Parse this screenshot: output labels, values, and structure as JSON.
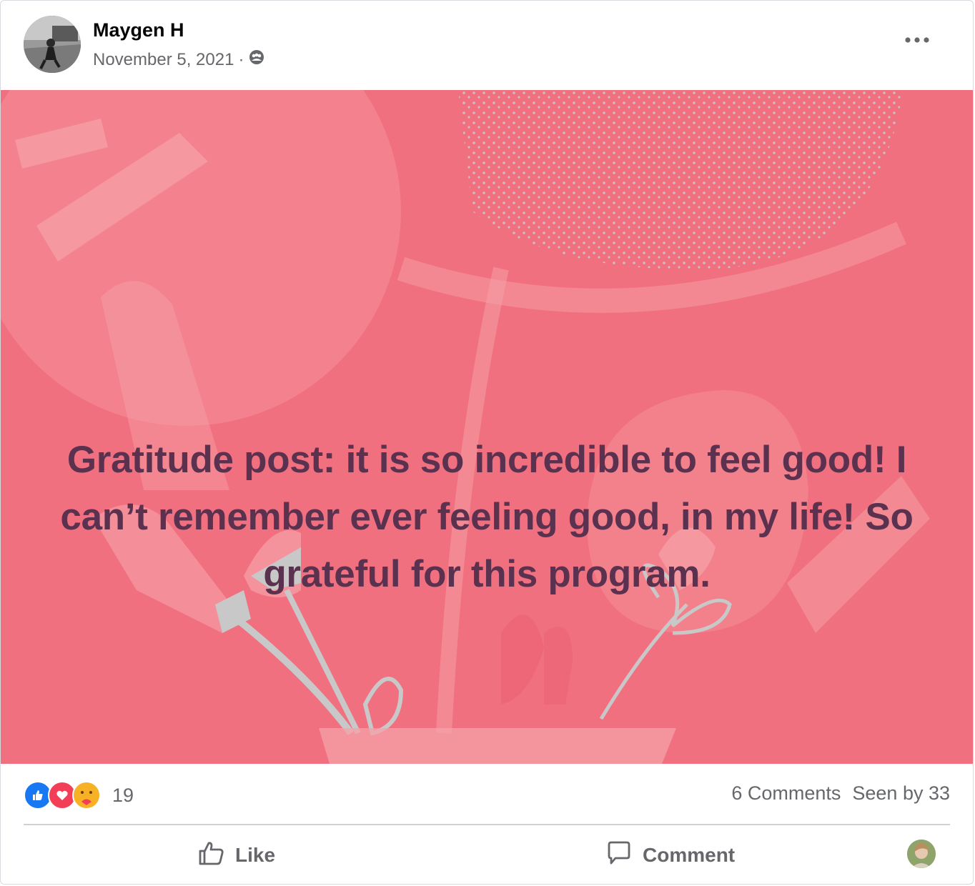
{
  "post": {
    "author": "Maygen H",
    "date": "November 5, 2021",
    "separator": "·",
    "audience_icon": "group-icon",
    "more_icon": "more-options-icon",
    "text": "Gratitude post: it is so incredible to feel good! I can’t remember ever feeling good, in my life! So grateful for this program.",
    "banner_color": "#f0707f",
    "text_color": "#5b3150"
  },
  "stats": {
    "reactions": [
      "like-reaction-icon",
      "love-reaction-icon",
      "care-reaction-icon"
    ],
    "reaction_count": "19",
    "comments": "6 Comments",
    "seen_by": "Seen by 33"
  },
  "actions": {
    "like_label": "Like",
    "comment_label": "Comment"
  }
}
